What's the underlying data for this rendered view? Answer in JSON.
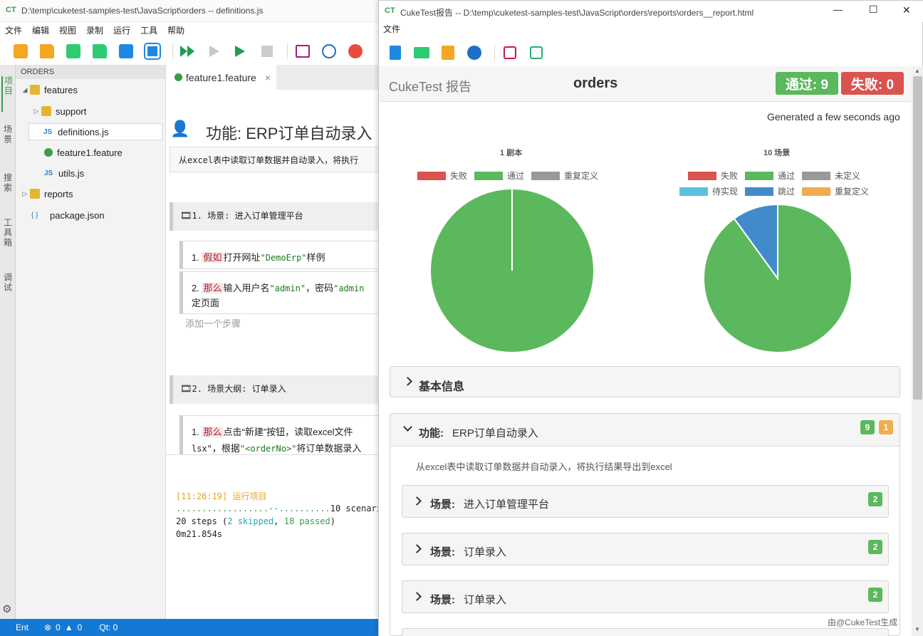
{
  "back_window": {
    "title": "D:\\temp\\cuketest-samples-test\\JavaScript\\orders -- definitions.js",
    "menu": [
      "文件",
      "编辑",
      "视图",
      "录制",
      "运行",
      "工具",
      "帮助"
    ],
    "side_tabs": [
      "项目",
      "场景",
      "搜索",
      "工具箱",
      "调试"
    ],
    "explorer": {
      "header": "ORDERS",
      "items": [
        {
          "label": "features",
          "kind": "folder",
          "expanded": true
        },
        {
          "label": "support",
          "kind": "folder",
          "expanded": false
        },
        {
          "label": "definitions.js",
          "kind": "js"
        },
        {
          "label": "feature1.feature",
          "kind": "feature"
        },
        {
          "label": "utils.js",
          "kind": "js"
        },
        {
          "label": "reports",
          "kind": "folder",
          "expanded": false
        },
        {
          "label": "package.json",
          "kind": "json"
        }
      ],
      "js_badge": "JS",
      "json_badge": "{ }"
    },
    "editor": {
      "tab_label": "feature1.feature",
      "tab_close": "×",
      "feature_title": "功能: ERP订单自动录入",
      "description": "从excel表中读取订单数据并自动录入，将执行",
      "scenario1": {
        "title": "1. 场景: 进入订单管理平台",
        "step1_num": "1.",
        "step1_kw": "假如",
        "step1_text": "打开网址",
        "step1_arg": "\"DemoErp\"",
        "step1_tail": "样例",
        "step2_num": "2.",
        "step2_kw": "那么",
        "step2_text": "输入用户名",
        "step2_arg": "\"admin\"",
        "step2_mid": "，密码",
        "step2_arg2": "\"admin",
        "step2_line2": "定页面",
        "add_step": "添加一个步骤"
      },
      "scenario2": {
        "title": "2. 场景大纲: 订单录入",
        "step1_num": "1.",
        "step1_kw": "那么",
        "step1_text": "点击“新建”按钮，读取excel文件",
        "step1_line2a": "lsx\"",
        "step1_line2b": "，根据",
        "step1_line2c": "\"<orderNo>\"",
        "step1_line2d": "将订单数据录入"
      }
    },
    "console": {
      "line1": "[11:26:19] 运行项目",
      "line2_dots": "..................--..........",
      "line2_tail": "10 scenari",
      "line3_a": "20 steps (",
      "line3_skipped": "2 skipped",
      "line3_sep": ", ",
      "line3_passed": "18 passed",
      "line3_end": ")",
      "line4": "0m21.854s"
    },
    "statusbar": {
      "ent": "Ent",
      "errors": "0",
      "warnings": "0",
      "qt": "Qt: 0"
    }
  },
  "front_window": {
    "title": "CukeTest报告 -- D:\\temp\\cuketest-samples-test\\JavaScript\\orders\\reports\\orders__report.html",
    "menu": "文件",
    "controls": {
      "minimize": "—",
      "maximize": "☐",
      "close": "✕"
    },
    "report": {
      "brand": "CukeTest 报告",
      "name": "orders",
      "passed_badge": "通过: 9",
      "failed_badge": "失败: 0",
      "generated": "Generated a few seconds ago",
      "chart1_title": "1 剧本",
      "chart1_legend": [
        "失败",
        "通过",
        "重复定义"
      ],
      "chart2_title": "10 场景",
      "chart2_legend_row1": [
        "失败",
        "通过",
        "未定义"
      ],
      "chart2_legend_row2": [
        "待实现",
        "跳过",
        "重复定义"
      ],
      "basic_info": "基本信息",
      "feature_label": "功能:",
      "feature_name": "ERP订单自动录入",
      "feature_pass_count": "9",
      "feature_skip_count": "1",
      "feature_desc": "从excel表中读取订单数据并自动录入，将执行结果导出到excel",
      "scenarios": [
        {
          "label": "场景:",
          "name": "进入订单管理平台",
          "count": "2"
        },
        {
          "label": "场景:",
          "name": "订单录入",
          "count": "2"
        },
        {
          "label": "场景:",
          "name": "订单录入",
          "count": "2"
        }
      ],
      "watermark": "由@CukeTest生成"
    },
    "colors": {
      "fail": "#d9534f",
      "pass": "#5cb85c",
      "undefined": "#999999",
      "pending": "#5bc0de",
      "skipped": "#428bca",
      "ambiguous": "#f0ad4e"
    }
  },
  "chart_data": [
    {
      "type": "pie",
      "title": "1 剧本",
      "labels": [
        "失败",
        "通过",
        "重复定义"
      ],
      "values": [
        0,
        1,
        0
      ]
    },
    {
      "type": "pie",
      "title": "10 场景",
      "labels": [
        "失败",
        "通过",
        "未定义",
        "待实现",
        "跳过",
        "重复定义"
      ],
      "values": [
        0,
        9,
        0,
        0,
        1,
        0
      ]
    }
  ]
}
